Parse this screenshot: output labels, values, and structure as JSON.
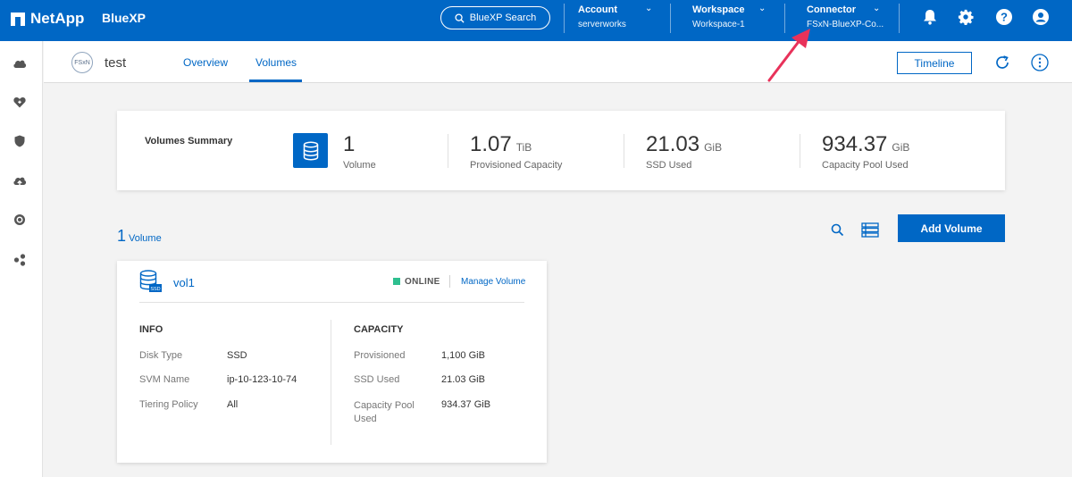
{
  "topbar": {
    "brand": "NetApp",
    "product": "BlueXP",
    "search_label": "BlueXP Search",
    "account": {
      "label": "Account",
      "value": "serverworks"
    },
    "workspace": {
      "label": "Workspace",
      "value": "Workspace-1"
    },
    "connector": {
      "label": "Connector",
      "value": "FSxN-BlueXP-Co..."
    },
    "icons": [
      "bell-icon",
      "gear-icon",
      "help-icon",
      "user-icon"
    ]
  },
  "rail": {
    "icons": [
      "cloud-icon",
      "health-icon",
      "shield-icon",
      "cloud-upload-icon",
      "target-icon",
      "share-icon"
    ]
  },
  "subheader": {
    "badge": "FSxN",
    "env_name": "test",
    "tabs": [
      {
        "label": "Overview",
        "active": false
      },
      {
        "label": "Volumes",
        "active": true
      }
    ],
    "timeline_label": "Timeline"
  },
  "summary": {
    "title": "Volumes Summary",
    "stats": [
      {
        "value": "1",
        "unit": "",
        "caption": "Volume"
      },
      {
        "value": "1.07",
        "unit": "TiB",
        "caption": "Provisioned Capacity"
      },
      {
        "value": "21.03",
        "unit": "GiB",
        "caption": "SSD Used"
      },
      {
        "value": "934.37",
        "unit": "GiB",
        "caption": "Capacity Pool Used"
      }
    ]
  },
  "volumes": {
    "count": "1",
    "count_word": "Volume",
    "add_label": "Add Volume"
  },
  "volume_card": {
    "name": "vol1",
    "icon_badge": "SSD",
    "status": "ONLINE",
    "manage_label": "Manage Volume",
    "info": {
      "title": "INFO",
      "rows": [
        {
          "key": "Disk Type",
          "value": "SSD"
        },
        {
          "key": "SVM Name",
          "value": "ip-10-123-10-74"
        },
        {
          "key": "Tiering Policy",
          "value": "All"
        }
      ]
    },
    "capacity": {
      "title": "CAPACITY",
      "rows": [
        {
          "key": "Provisioned",
          "value": "1,100 GiB"
        },
        {
          "key": "SSD Used",
          "value": "21.03 GiB"
        },
        {
          "key": "Capacity Pool Used",
          "value": "934.37 GiB"
        }
      ]
    }
  },
  "colors": {
    "primary": "#0067c5",
    "online": "#2ebf8f",
    "annotation": "#e8325a"
  }
}
